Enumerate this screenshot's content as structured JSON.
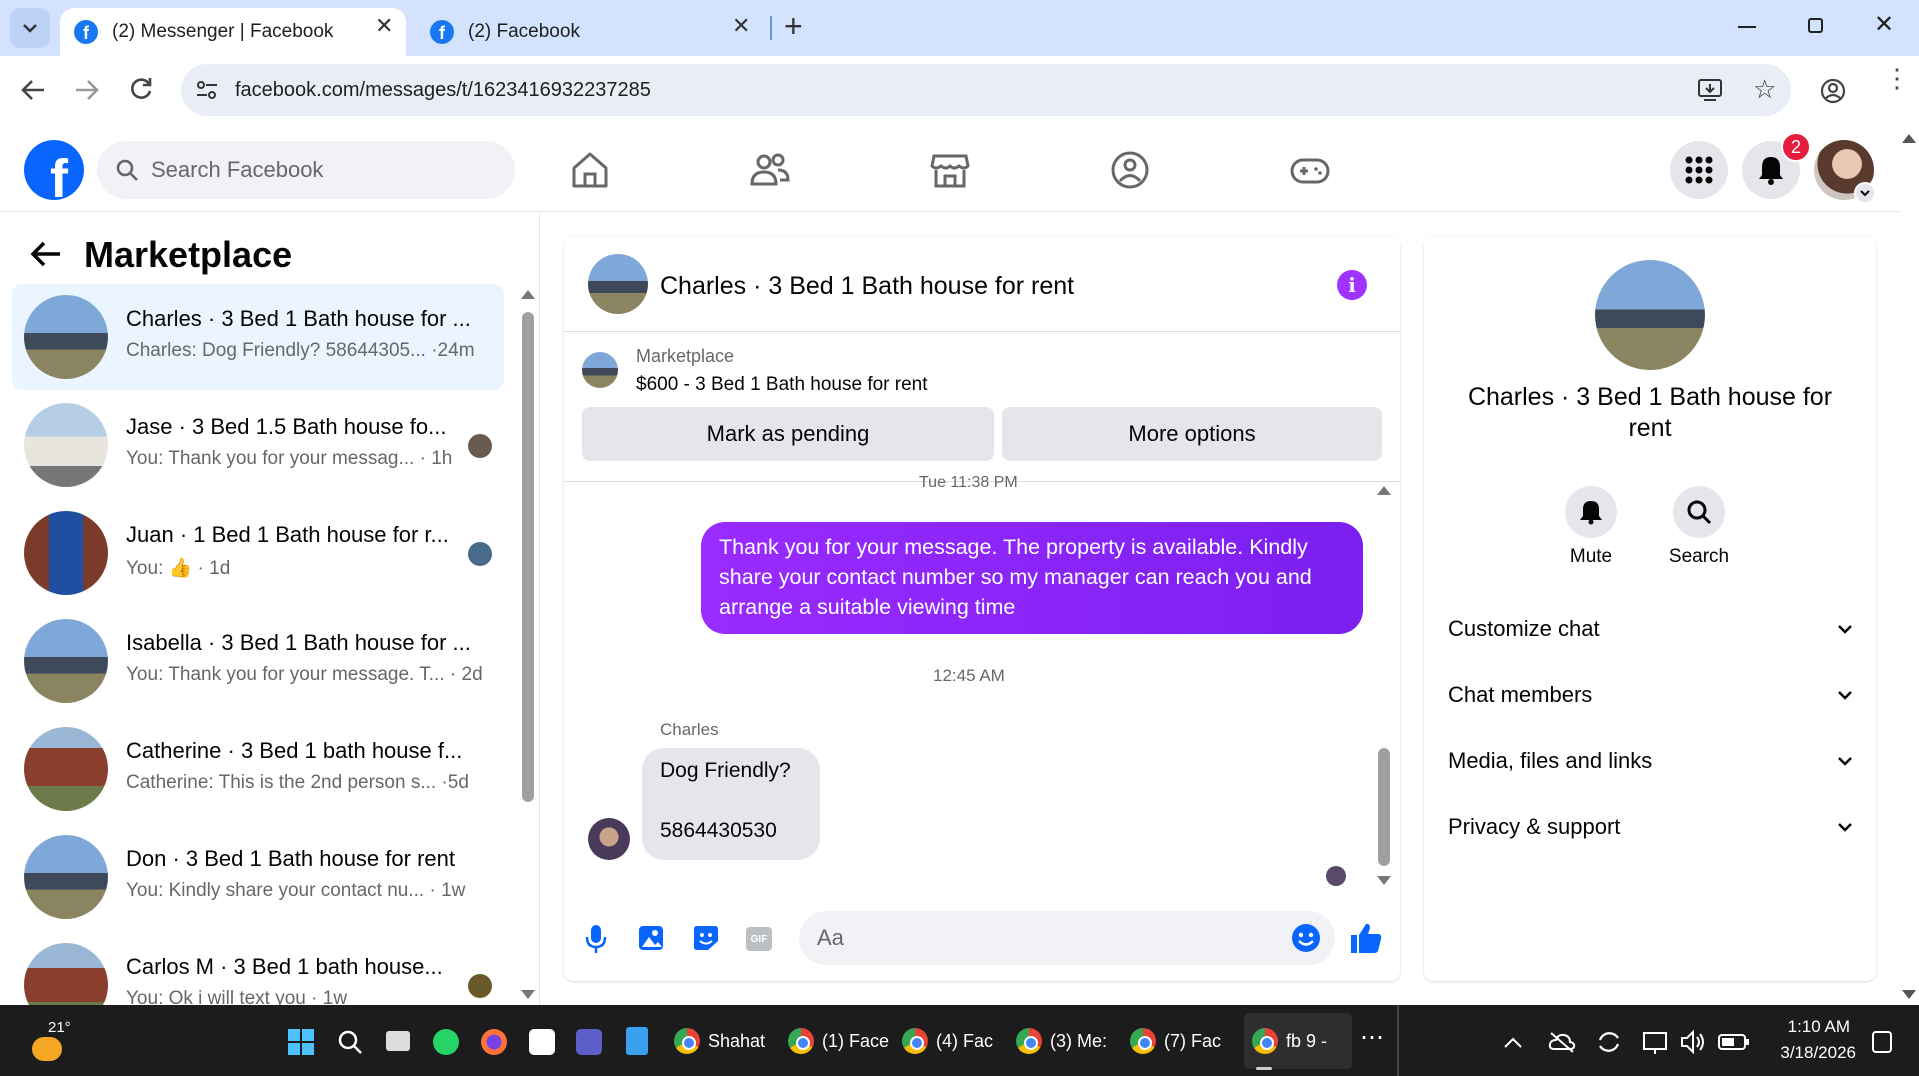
{
  "browser": {
    "tabs": [
      {
        "title": "(2) Messenger | Facebook",
        "active": true
      },
      {
        "title": "(2) Facebook",
        "active": false
      }
    ],
    "url": "facebook.com/messages/t/1623416932237285",
    "new_tab": "+"
  },
  "header": {
    "search_placeholder": "Search Facebook",
    "notification_count": "2"
  },
  "left_panel": {
    "title": "Marketplace",
    "conversations": [
      {
        "name": "Charles · 3 Bed 1 Bath house for ...",
        "preview": "Charles: Dog Friendly? 58644305... ·24m",
        "selected": true
      },
      {
        "name": "Jase · 3 Bed 1.5 Bath house fo...",
        "preview": "You: Thank you for your messag... · 1h"
      },
      {
        "name": "Juan · 1 Bed 1 Bath house for r...",
        "preview": "You: 👍 · 1d"
      },
      {
        "name": "Isabella · 3 Bed 1 Bath house for ...",
        "preview": "You: Thank you for your message. T... · 2d"
      },
      {
        "name": "Catherine · 3 Bed 1 bath house f...",
        "preview": "Catherine: This is the 2nd person s... ·5d"
      },
      {
        "name": "Don · 3 Bed 1 Bath house for rent",
        "preview": "You: Kindly share your contact nu... · 1w"
      },
      {
        "name": "Carlos M · 3 Bed 1 bath house...",
        "preview": "You: Ok i will text you · 1w"
      }
    ]
  },
  "chat": {
    "title": "Charles · 3 Bed 1 Bath house for rent",
    "listing_source": "Marketplace",
    "listing_title": "$600 - 3 Bed 1 Bath house for rent",
    "mark_pending": "Mark as pending",
    "more_options": "More options",
    "timestamp1": "Tue 11:38 PM",
    "outgoing_message": "Thank you for your message. The property is available. Kindly share your contact number so my manager can reach you and arrange a suitable viewing time",
    "timestamp2": "12:45 AM",
    "sender": "Charles",
    "incoming_line1": "Dog Friendly?",
    "incoming_line2": "5864430530",
    "composer_placeholder": "Aa"
  },
  "right_panel": {
    "name": "Charles · 3 Bed 1 Bath house for rent",
    "mute_label": "Mute",
    "search_label": "Search",
    "sections": [
      "Customize chat",
      "Chat members",
      "Media, files and links",
      "Privacy & support"
    ]
  },
  "taskbar": {
    "weather": "21°",
    "apps": [
      "Shahat",
      "(1) Face",
      "(4) Fac",
      "(3) Me:",
      "(7) Fac",
      "fb 9 -"
    ],
    "time": "1:10 AM",
    "date": "3/18/2026"
  },
  "colors": {
    "fb_blue": "#0866ff",
    "messenger_purple": "#8a2be2",
    "selected_bg": "#ebf5ff"
  }
}
